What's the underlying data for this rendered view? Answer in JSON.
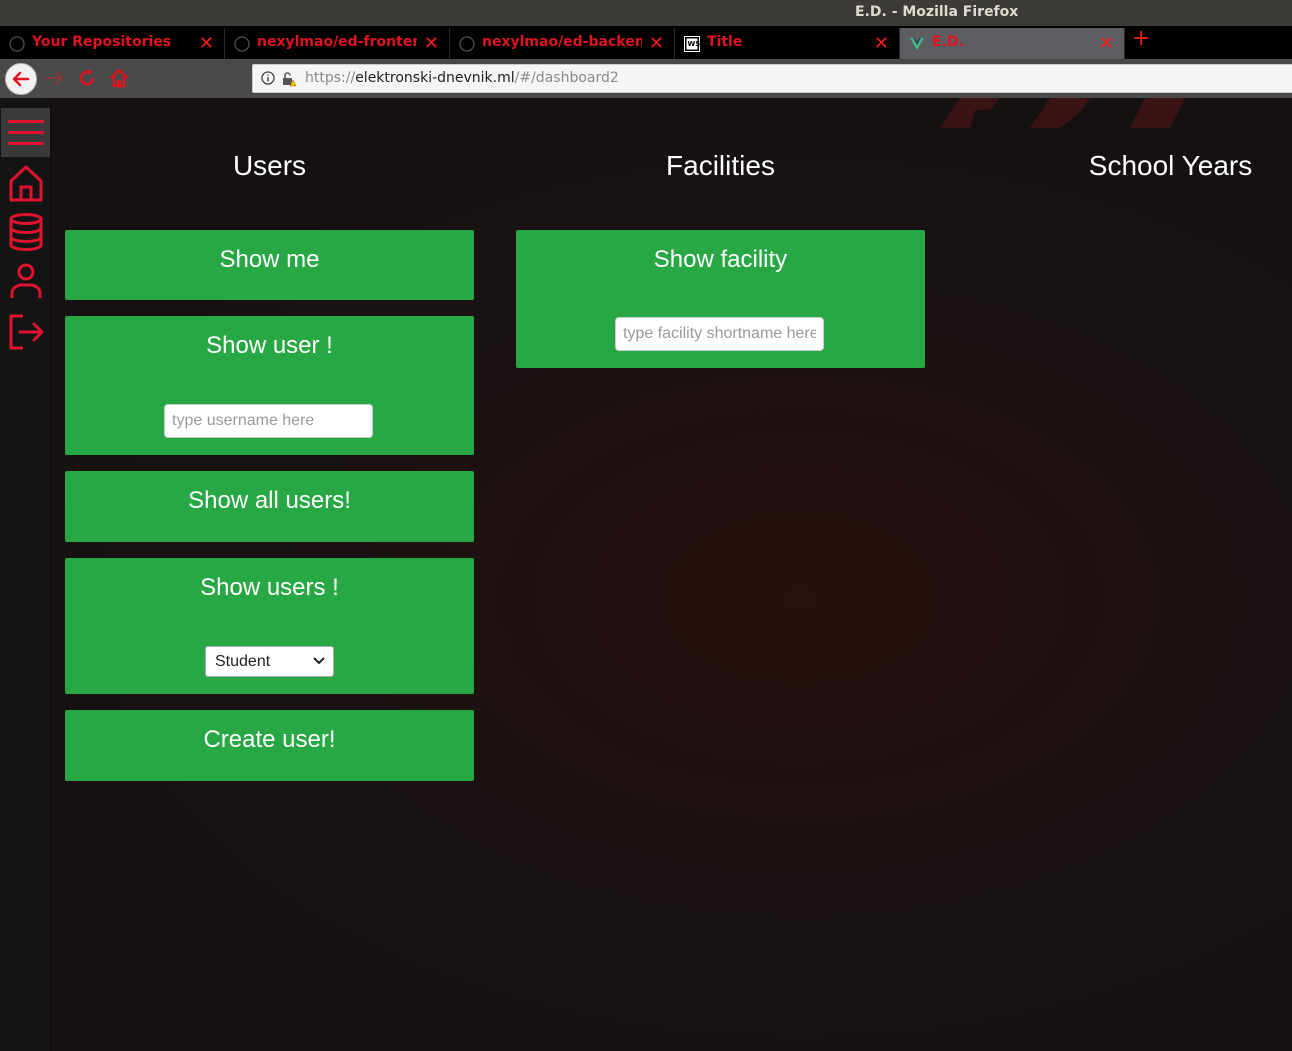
{
  "window": {
    "title": "E.D. - Mozilla Firefox"
  },
  "tabs": [
    {
      "label": "Your Repositories",
      "icon": "github-icon"
    },
    {
      "label": "nexylmao/ed-frontend: ",
      "icon": "github-icon"
    },
    {
      "label": "nexylmao/ed-backend: ",
      "icon": "github-icon"
    },
    {
      "label": "Title",
      "icon": "webstorm-icon"
    },
    {
      "label": "E.D.",
      "icon": "vue-icon",
      "active": true
    }
  ],
  "navbar": {
    "url_prefix": "https://",
    "url_host": "elektronski-dnevnik.ml",
    "url_path": "/#/dashboard2"
  },
  "sidebar": {
    "items": [
      "hamburger-menu-icon",
      "home-icon",
      "database-icon",
      "user-icon",
      "logout-icon"
    ],
    "accent": "#e0132f"
  },
  "columns": {
    "users": "Users",
    "facilities": "Facilities",
    "school_years": "School Years"
  },
  "users": {
    "show_me": "Show me",
    "show_user": "Show user !",
    "username_placeholder": "type username here",
    "show_all_users": "Show all users!",
    "show_users": "Show users !",
    "role_selected": "Student",
    "create_user": "Create user!"
  },
  "facilities": {
    "show_facility": "Show facility",
    "shortname_placeholder": "type facility shortname here"
  },
  "colors": {
    "card": "#28a745",
    "tab_text": "#e0131f"
  }
}
